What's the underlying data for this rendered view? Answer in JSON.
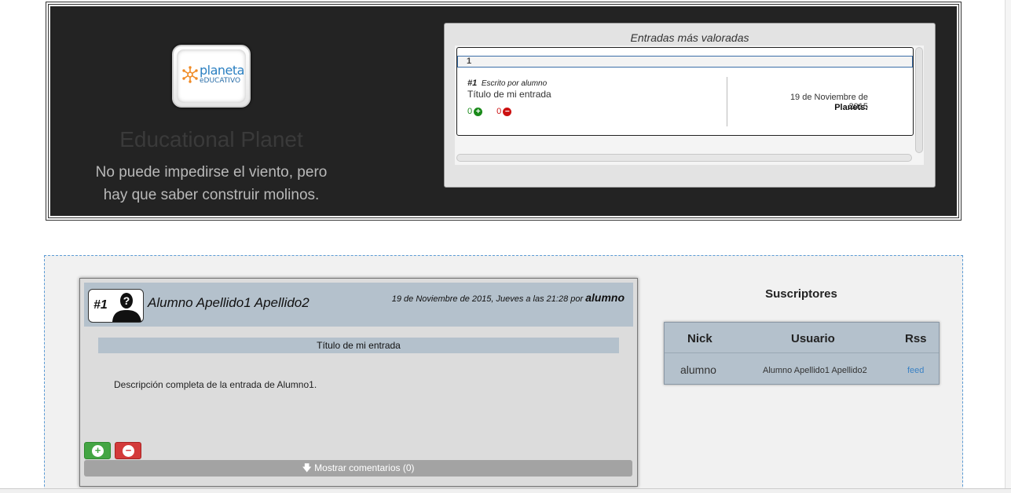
{
  "header": {
    "logo_line1": "planeta",
    "logo_line2": "eDUCATIVO",
    "site_title": "Educational Planet",
    "slogan_line1": "No puede impedirse el viento, pero",
    "slogan_line2": "hay que saber construir molinos."
  },
  "top_rated": {
    "heading": "Entradas más valoradas",
    "rank": "1",
    "entry_number": "#1",
    "written_by": "Escrito por alumno",
    "entry_title": "Título de mi entrada",
    "upvotes": "0",
    "downvotes": "0",
    "date": "19 de Noviembre de 2015",
    "planets_label": "Planets:"
  },
  "post": {
    "number": "#1",
    "author_full_name": "Alumno Apellido1 Apellido2",
    "date_text": "19 de Noviembre de 2015, Jueves a las 21:28 por",
    "author_nick": "alumno",
    "title": "Título de mi entrada",
    "description": "Descripción completa de la entrada de Alumno1.",
    "show_comments": "Mostrar comentarios (0)"
  },
  "subscribers": {
    "title": "Suscriptores",
    "columns": [
      "Nick",
      "Usuario",
      "Rss"
    ],
    "rows": [
      {
        "nick": "alumno",
        "usuario": "Alumno Apellido1 Apellido2",
        "rss": "feed"
      }
    ]
  },
  "colors": {
    "upvote": "#43a543",
    "downvote": "#d33a3a",
    "header_bg": "#232323",
    "accent_bar": "#b4c1cc",
    "link": "#3b82c4"
  }
}
